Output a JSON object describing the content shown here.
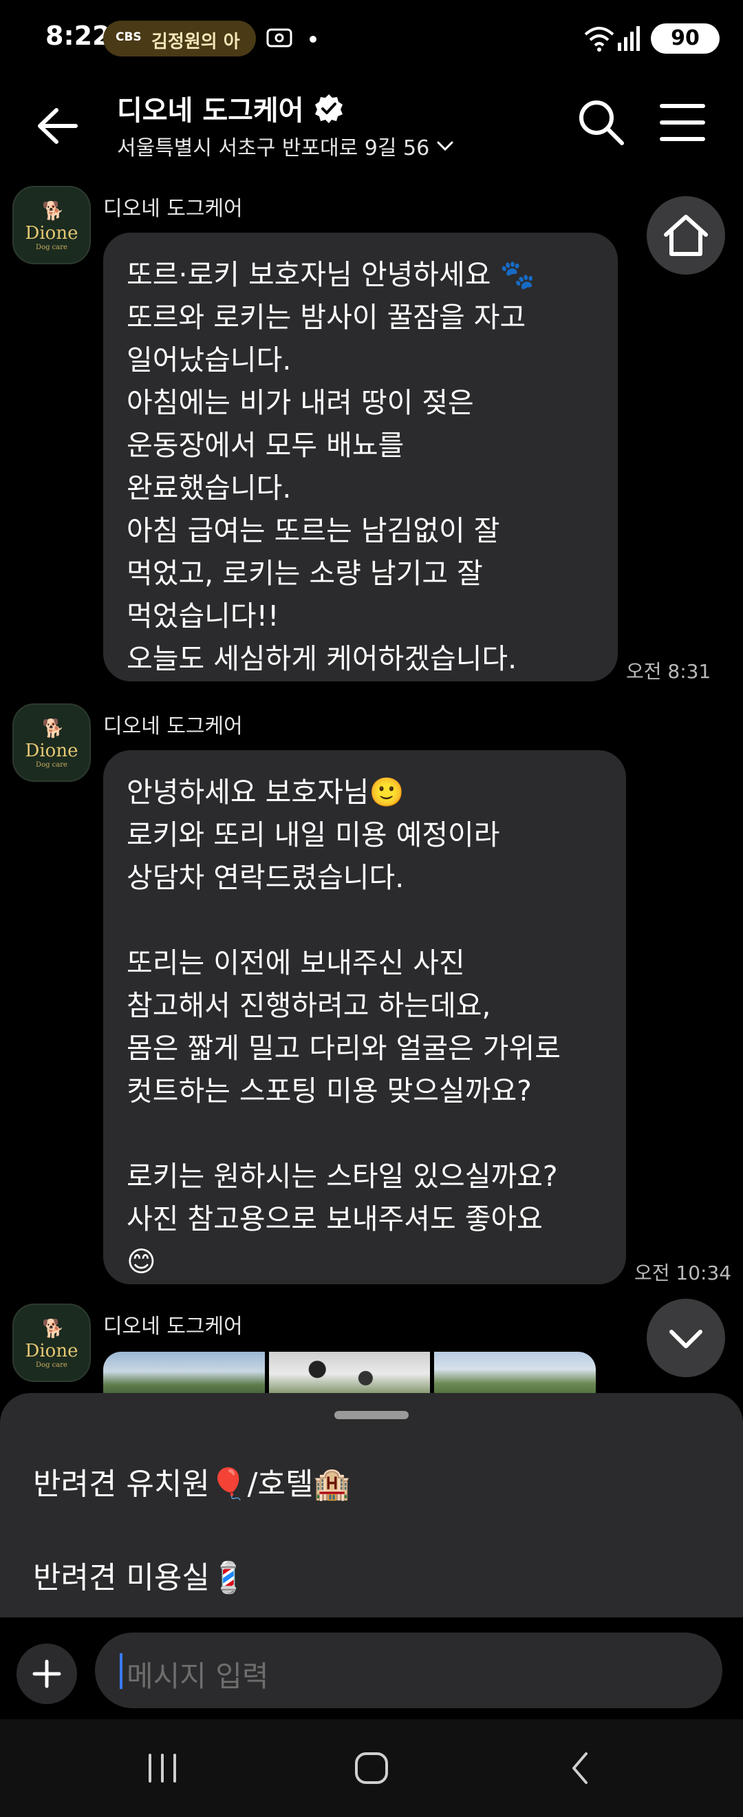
{
  "status": {
    "time": "8:22",
    "pill_logo": "CBS",
    "pill_text": "김정원의 아",
    "battery": "90"
  },
  "header": {
    "title": "디오네 도그케어",
    "subtitle": "서울특별시 서초구 반포대로 9길 56"
  },
  "avatar": {
    "brand": "Dione",
    "sub": "Dog care"
  },
  "messages": [
    {
      "sender": "디오네 도그케어",
      "text": "또르·로키 보호자님 안녕하세요 🐾\n또르와 로키는 밤사이 꿀잠을 자고\n일어났습니다.\n아침에는 비가 내려 땅이 젖은\n운동장에서 모두 배뇨를\n완료했습니다.\n아침 급여는 또르는 남김없이 잘\n먹었고, 로키는 소량 남기고 잘\n먹었습니다!!\n오늘도 세심하게 케어하겠습니다.",
      "time": "오전 8:31"
    },
    {
      "sender": "디오네 도그케어",
      "text": "안녕하세요 보호자님🙂\n로키와 또리 내일 미용 예정이라\n상담차 연락드렸습니다.\n\n또리는 이전에 보내주신 사진\n참고해서 진행하려고 하는데요,\n몸은 짧게 밀고 다리와 얼굴은 가위로\n컷트하는 스포팅 미용 맞으실까요?\n\n로키는 원하시는 스타일 있으실까요?\n사진 참고용으로 보내주셔도 좋아요\n😊",
      "time": "오전 10:34"
    },
    {
      "sender": "디오네 도그케어"
    }
  ],
  "menu": {
    "items": [
      {
        "label": "반려견 유치원🎈/호텔🏨"
      },
      {
        "label": "반려견 미용실💈"
      }
    ]
  },
  "input": {
    "placeholder": "메시지 입력"
  },
  "icons": {
    "back": "arrow-left-icon",
    "verified": "verified-badge-icon",
    "search": "search-icon",
    "menu": "hamburger-menu-icon",
    "home": "home-icon",
    "scroll": "chevron-down-icon",
    "plus": "plus-icon"
  },
  "colors": {
    "background": "#000000",
    "bubble": "#2b2b2d",
    "accent_cursor": "#3a7bff",
    "brand_gold": "#e4c774"
  }
}
